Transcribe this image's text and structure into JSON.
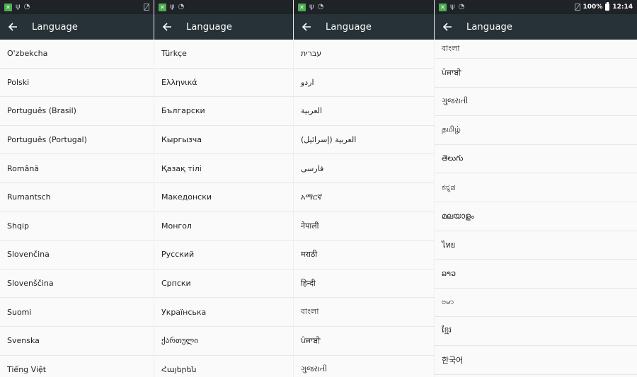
{
  "screens": [
    {
      "status": {
        "show_battery": false
      },
      "appbar": {
        "title": "Language"
      },
      "languages": [
        "O'zbekcha",
        "Polski",
        "Português (Brasil)",
        "Português (Portugal)",
        "Română",
        "Rumantsch",
        "Shqip",
        "Slovenčina",
        "Slovenščina",
        "Suomi",
        "Svenska",
        "Tiếng Việt"
      ]
    },
    {
      "appbar": {
        "title": "Language"
      },
      "languages": [
        "Türkçe",
        "Ελληνικά",
        "Български",
        "Кыргызча",
        "Қазақ тілі",
        "Македонски",
        "Монгол",
        "Русский",
        "Српски",
        "Українська",
        "ქართული",
        "Հայերեն"
      ]
    },
    {
      "appbar": {
        "title": "Language"
      },
      "languages": [
        "עברית",
        "اردو",
        "العربية",
        "العربية (إسرائيل)",
        "فارسی",
        "አማርኛ",
        "नेपाली",
        "मराठी",
        "हिन्दी",
        "বাংলা",
        "ਪੰਜਾਬੀ",
        "ગુજરાતી"
      ]
    },
    {
      "status": {
        "battery": "100%",
        "time": "12:14"
      },
      "appbar": {
        "title": "Language"
      },
      "languages": [
        "বাংলা",
        "ਪੰਜਾਬੀ",
        "ગુજરાતી",
        "தமிழ்",
        "తెలుగు",
        "ಕನ್ನಡ",
        "മലയാളം",
        "ไทย",
        "ລາວ",
        "ဗမာ",
        "ខ្មែរ",
        "한국어"
      ]
    }
  ],
  "icons": {
    "back": "arrow-back-icon",
    "app": "app-notification-icon",
    "usb": "usb-icon",
    "wifi": "wifi-icon",
    "no_sim": "no-sim-icon",
    "battery": "battery-icon"
  },
  "colors": {
    "statusbar": "#1f2327",
    "appbar": "#263238",
    "list_bg": "#fafafa",
    "divider": "#e6e6e6",
    "text": "#212121"
  }
}
